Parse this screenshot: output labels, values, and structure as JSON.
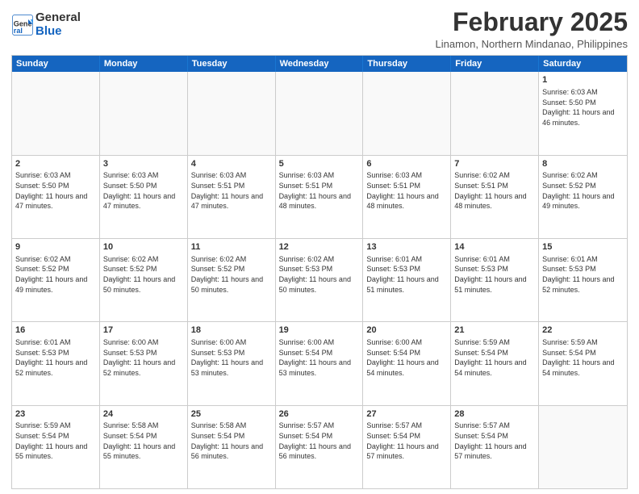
{
  "logo": {
    "general": "General",
    "blue": "Blue"
  },
  "header": {
    "month": "February 2025",
    "location": "Linamon, Northern Mindanao, Philippines"
  },
  "weekdays": [
    "Sunday",
    "Monday",
    "Tuesday",
    "Wednesday",
    "Thursday",
    "Friday",
    "Saturday"
  ],
  "rows": [
    [
      {
        "day": "",
        "info": ""
      },
      {
        "day": "",
        "info": ""
      },
      {
        "day": "",
        "info": ""
      },
      {
        "day": "",
        "info": ""
      },
      {
        "day": "",
        "info": ""
      },
      {
        "day": "",
        "info": ""
      },
      {
        "day": "1",
        "info": "Sunrise: 6:03 AM\nSunset: 5:50 PM\nDaylight: 11 hours and 46 minutes."
      }
    ],
    [
      {
        "day": "2",
        "info": "Sunrise: 6:03 AM\nSunset: 5:50 PM\nDaylight: 11 hours and 47 minutes."
      },
      {
        "day": "3",
        "info": "Sunrise: 6:03 AM\nSunset: 5:50 PM\nDaylight: 11 hours and 47 minutes."
      },
      {
        "day": "4",
        "info": "Sunrise: 6:03 AM\nSunset: 5:51 PM\nDaylight: 11 hours and 47 minutes."
      },
      {
        "day": "5",
        "info": "Sunrise: 6:03 AM\nSunset: 5:51 PM\nDaylight: 11 hours and 48 minutes."
      },
      {
        "day": "6",
        "info": "Sunrise: 6:03 AM\nSunset: 5:51 PM\nDaylight: 11 hours and 48 minutes."
      },
      {
        "day": "7",
        "info": "Sunrise: 6:02 AM\nSunset: 5:51 PM\nDaylight: 11 hours and 48 minutes."
      },
      {
        "day": "8",
        "info": "Sunrise: 6:02 AM\nSunset: 5:52 PM\nDaylight: 11 hours and 49 minutes."
      }
    ],
    [
      {
        "day": "9",
        "info": "Sunrise: 6:02 AM\nSunset: 5:52 PM\nDaylight: 11 hours and 49 minutes."
      },
      {
        "day": "10",
        "info": "Sunrise: 6:02 AM\nSunset: 5:52 PM\nDaylight: 11 hours and 50 minutes."
      },
      {
        "day": "11",
        "info": "Sunrise: 6:02 AM\nSunset: 5:52 PM\nDaylight: 11 hours and 50 minutes."
      },
      {
        "day": "12",
        "info": "Sunrise: 6:02 AM\nSunset: 5:53 PM\nDaylight: 11 hours and 50 minutes."
      },
      {
        "day": "13",
        "info": "Sunrise: 6:01 AM\nSunset: 5:53 PM\nDaylight: 11 hours and 51 minutes."
      },
      {
        "day": "14",
        "info": "Sunrise: 6:01 AM\nSunset: 5:53 PM\nDaylight: 11 hours and 51 minutes."
      },
      {
        "day": "15",
        "info": "Sunrise: 6:01 AM\nSunset: 5:53 PM\nDaylight: 11 hours and 52 minutes."
      }
    ],
    [
      {
        "day": "16",
        "info": "Sunrise: 6:01 AM\nSunset: 5:53 PM\nDaylight: 11 hours and 52 minutes."
      },
      {
        "day": "17",
        "info": "Sunrise: 6:00 AM\nSunset: 5:53 PM\nDaylight: 11 hours and 52 minutes."
      },
      {
        "day": "18",
        "info": "Sunrise: 6:00 AM\nSunset: 5:53 PM\nDaylight: 11 hours and 53 minutes."
      },
      {
        "day": "19",
        "info": "Sunrise: 6:00 AM\nSunset: 5:54 PM\nDaylight: 11 hours and 53 minutes."
      },
      {
        "day": "20",
        "info": "Sunrise: 6:00 AM\nSunset: 5:54 PM\nDaylight: 11 hours and 54 minutes."
      },
      {
        "day": "21",
        "info": "Sunrise: 5:59 AM\nSunset: 5:54 PM\nDaylight: 11 hours and 54 minutes."
      },
      {
        "day": "22",
        "info": "Sunrise: 5:59 AM\nSunset: 5:54 PM\nDaylight: 11 hours and 54 minutes."
      }
    ],
    [
      {
        "day": "23",
        "info": "Sunrise: 5:59 AM\nSunset: 5:54 PM\nDaylight: 11 hours and 55 minutes."
      },
      {
        "day": "24",
        "info": "Sunrise: 5:58 AM\nSunset: 5:54 PM\nDaylight: 11 hours and 55 minutes."
      },
      {
        "day": "25",
        "info": "Sunrise: 5:58 AM\nSunset: 5:54 PM\nDaylight: 11 hours and 56 minutes."
      },
      {
        "day": "26",
        "info": "Sunrise: 5:57 AM\nSunset: 5:54 PM\nDaylight: 11 hours and 56 minutes."
      },
      {
        "day": "27",
        "info": "Sunrise: 5:57 AM\nSunset: 5:54 PM\nDaylight: 11 hours and 57 minutes."
      },
      {
        "day": "28",
        "info": "Sunrise: 5:57 AM\nSunset: 5:54 PM\nDaylight: 11 hours and 57 minutes."
      },
      {
        "day": "",
        "info": ""
      }
    ]
  ]
}
